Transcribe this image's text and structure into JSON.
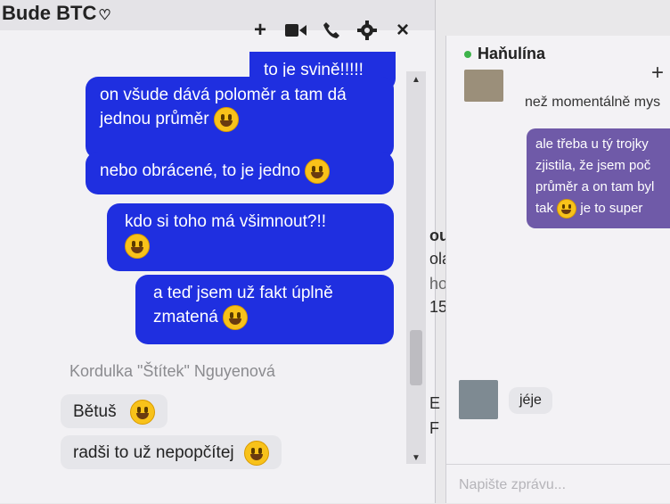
{
  "left_chat": {
    "title": "Bude BTC",
    "heart": "♡",
    "tools": {
      "add": "+",
      "video": "video-icon",
      "call": "phone-icon",
      "settings": "gear-icon",
      "close": "×"
    },
    "messages_out": [
      "to je svině!!!!!",
      "on všude dává poloměr a tam dá jednou průměr",
      "nebo obrácené, to je jedno",
      "kdo si toho má všimnout?!!",
      "a teď jsem už fakt úplně zmatená"
    ],
    "sender": "Kordulka \"Štítek\" Nguyenová",
    "messages_in": [
      "Bětuš",
      "radši to už nepopčítej"
    ]
  },
  "background_text": [
    "ou",
    "olal",
    "hoi",
    "15",
    "E",
    "F"
  ],
  "right_chat": {
    "name": "Haňulína",
    "plus": "+",
    "preview": "než momentálně mys",
    "purple_lines": [
      "ale třeba u tý trojky",
      "zjistila, že jsem poč",
      "průměr a on tam byl",
      "tak",
      "je to super"
    ],
    "reply": "jéje",
    "input_placeholder": "Napište zprávu..."
  }
}
